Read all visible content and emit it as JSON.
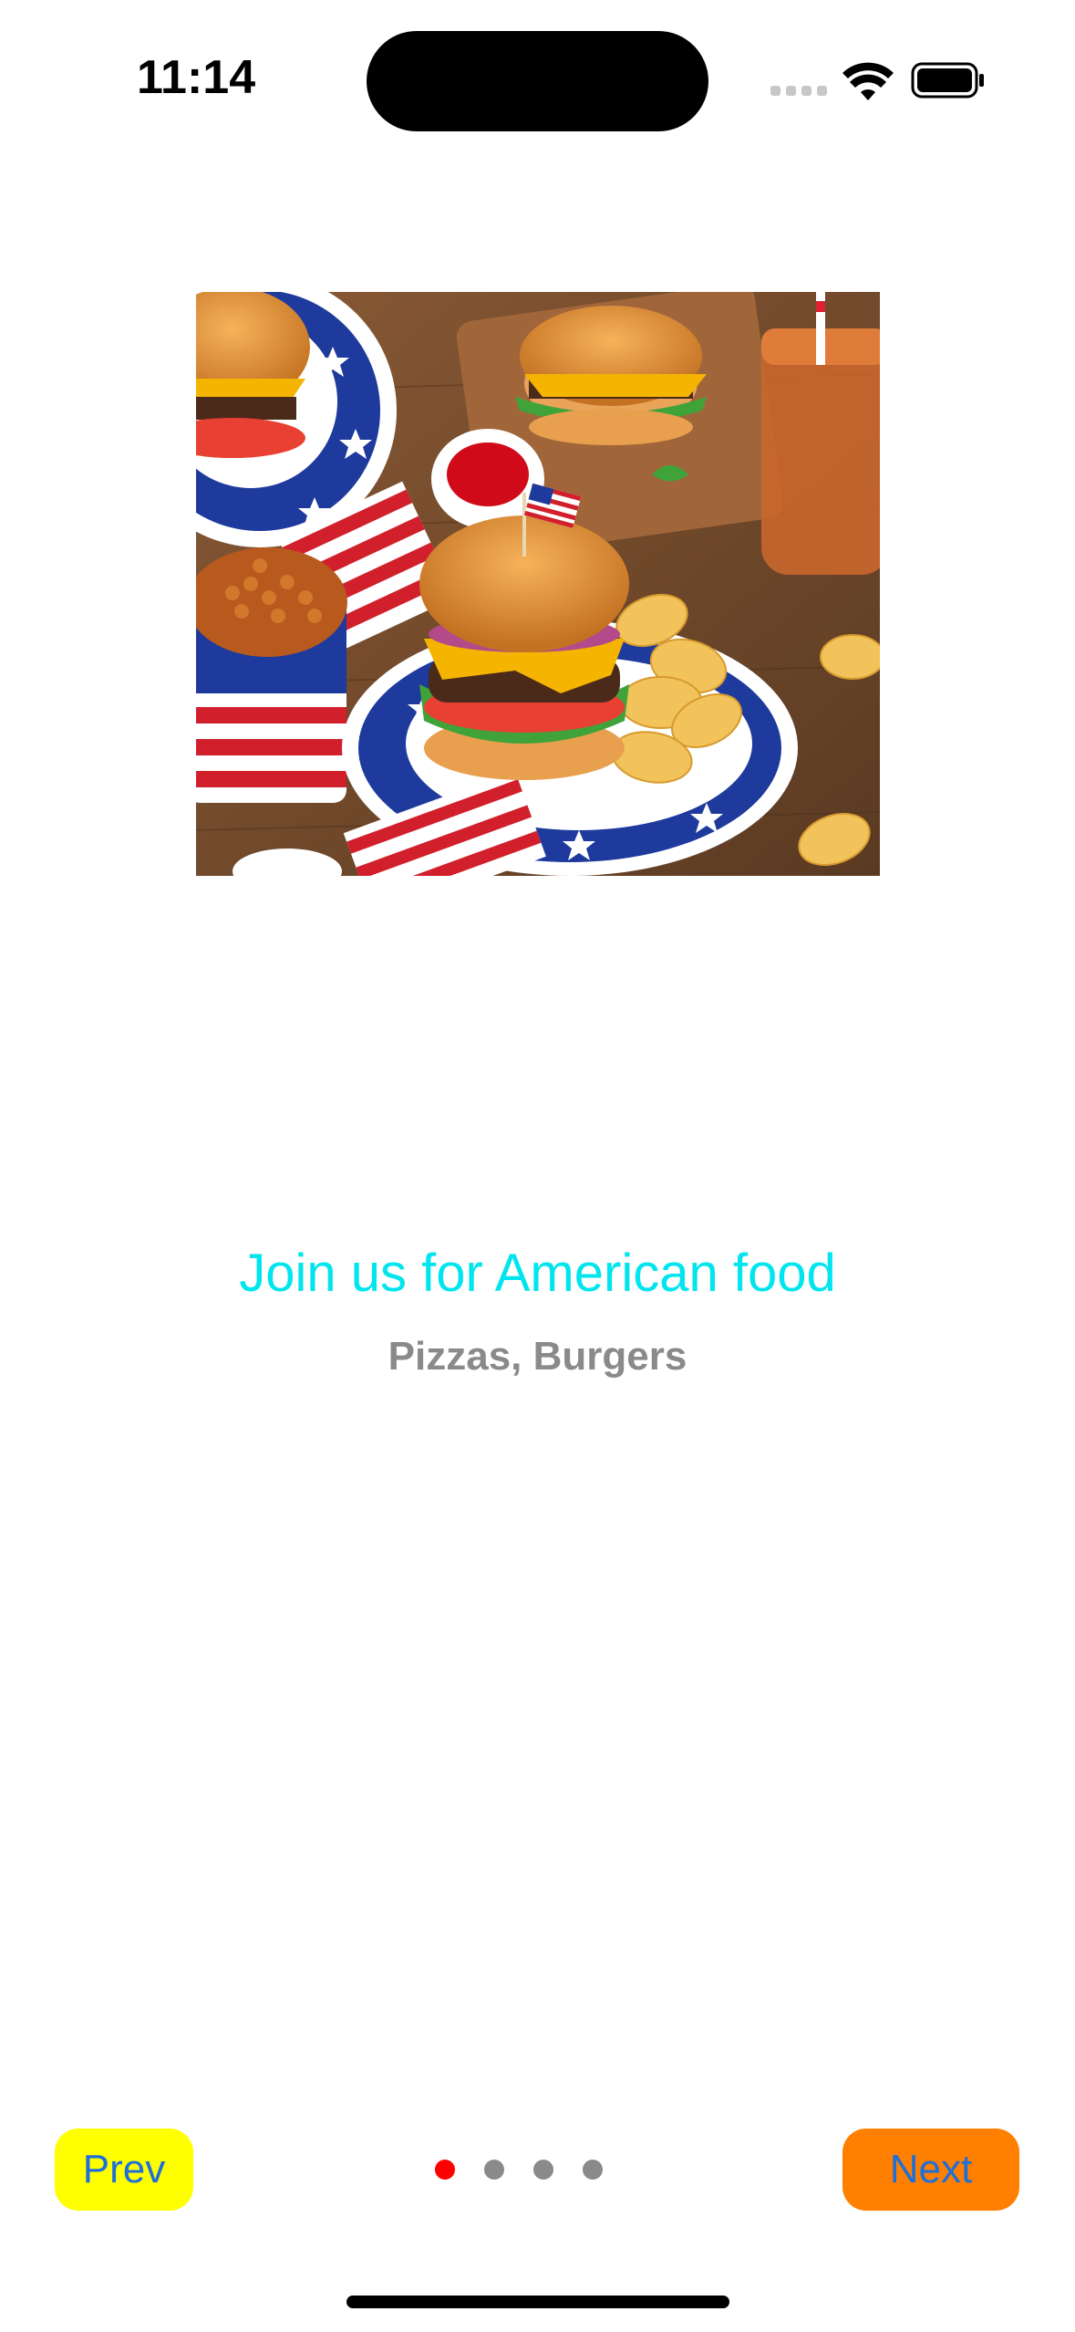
{
  "status_bar": {
    "time": "11:14"
  },
  "onboarding": {
    "image_alt": "American food: burgers, fries, baked beans and iced tea",
    "title": "Join us for American food",
    "subtitle": "Pizzas, Burgers"
  },
  "navigation": {
    "prev_label": "Prev",
    "next_label": "Next",
    "page_count": 4,
    "current_page": 1
  },
  "colors": {
    "title": "#00e5ee",
    "subtitle": "#8a8a8a",
    "prev_bg": "#ffff00",
    "next_bg": "#ff7f00",
    "button_text": "#1e6fd9",
    "active_dot": "#ff0000",
    "inactive_dot": "#8a8a8a"
  }
}
